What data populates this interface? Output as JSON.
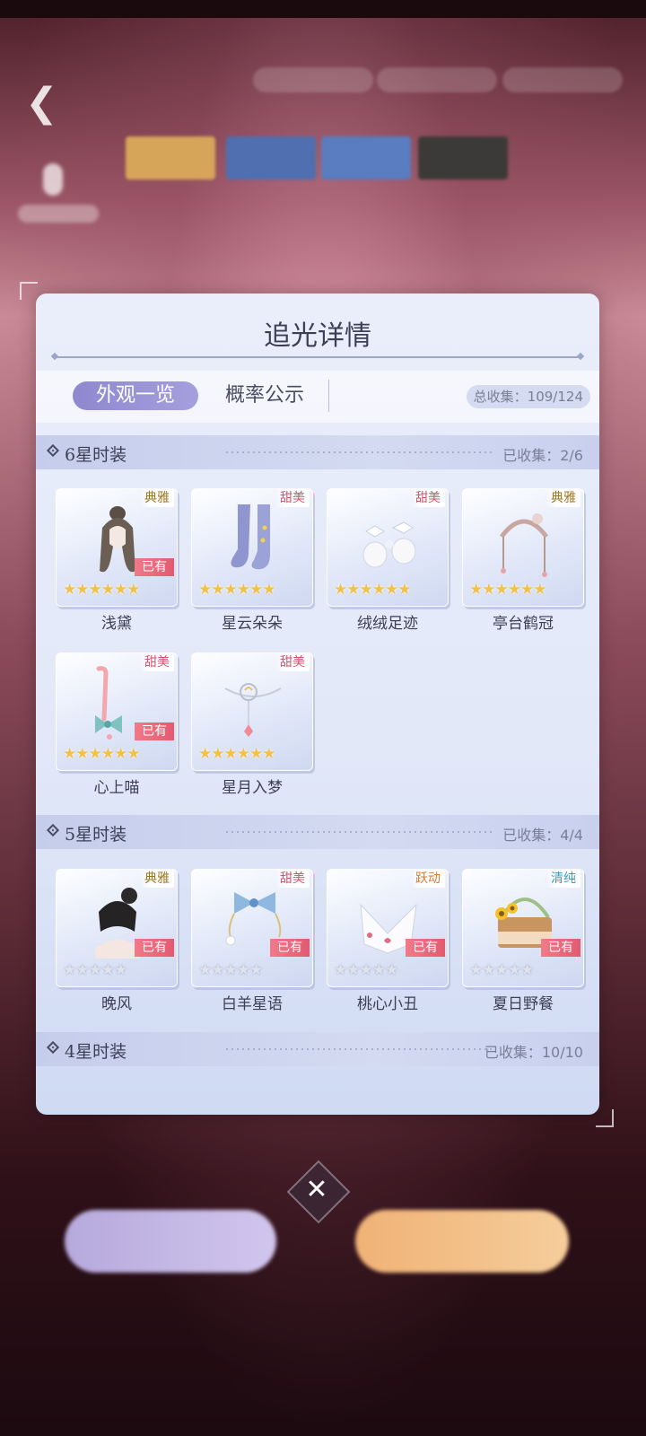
{
  "panel": {
    "title": "追光详情",
    "tabs": [
      {
        "label": "外观一览",
        "active": true
      },
      {
        "label": "概率公示",
        "active": false
      }
    ],
    "total_collect": "总收集：109/124"
  },
  "sections": [
    {
      "title": "6星时装",
      "collected": "已收集：2/6",
      "items": [
        {
          "name": "浅黛",
          "tag": "典雅",
          "owned": "已有",
          "stars": "★★★★★★",
          "art": "hair-icon"
        },
        {
          "name": "星云朵朵",
          "tag": "甜美",
          "owned": "",
          "stars": "★★★★★★",
          "art": "socks-icon"
        },
        {
          "name": "绒绒足迹",
          "tag": "甜美",
          "owned": "",
          "stars": "★★★★★★",
          "art": "shoes-icon"
        },
        {
          "name": "亭台鹤冠",
          "tag": "典雅",
          "owned": "",
          "stars": "★★★★★★",
          "art": "headdress-icon"
        },
        {
          "name": "心上喵",
          "tag": "甜美",
          "owned": "已有",
          "stars": "★★★★★★",
          "art": "tail-icon"
        },
        {
          "name": "星月入梦",
          "tag": "甜美",
          "owned": "",
          "stars": "★★★★★★",
          "art": "necklace-icon"
        }
      ]
    },
    {
      "title": "5星时装",
      "collected": "已收集：4/4",
      "items": [
        {
          "name": "晚风",
          "tag": "典雅",
          "owned": "已有",
          "stars": "★★★★★",
          "art": "hair-bun-icon"
        },
        {
          "name": "白羊星语",
          "tag": "甜美",
          "owned": "已有",
          "stars": "★★★★★",
          "art": "bow-headpiece-icon"
        },
        {
          "name": "桃心小丑",
          "tag": "跃动",
          "owned": "已有",
          "stars": "★★★★★",
          "art": "collar-icon"
        },
        {
          "name": "夏日野餐",
          "tag": "清纯",
          "owned": "已有",
          "stars": "★★★★★",
          "art": "basket-icon"
        }
      ]
    },
    {
      "title": "4星时装",
      "collected": "已收集：10/10",
      "items": []
    }
  ],
  "colors": {
    "accent": "#9a93d6",
    "owned_badge": "#e25a70",
    "tag_elegant": "#9a7620",
    "tag_sweet": "#d2546b",
    "tag_lively": "#d97a36",
    "tag_pure": "#3aa0b8"
  },
  "close_icon": "✕"
}
